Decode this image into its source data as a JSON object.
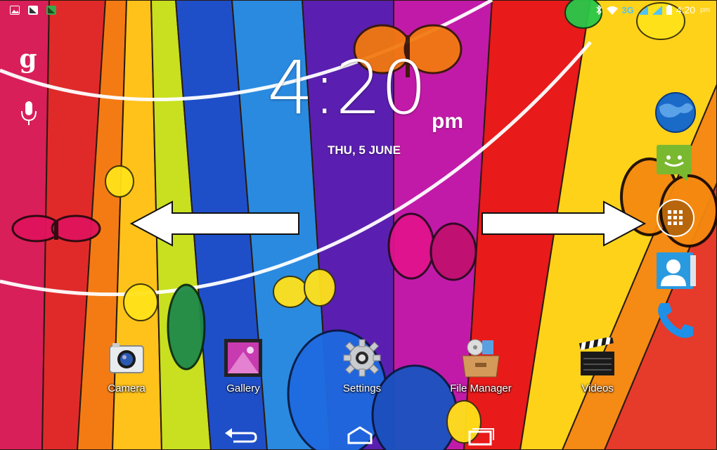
{
  "status_bar": {
    "left_icons": [
      "picture-notification-icon",
      "screenshot-notification-icon",
      "download-notification-icon"
    ],
    "network": "3G",
    "time": "4:20",
    "ampm": "pm"
  },
  "search": {
    "glyph": "g",
    "icon": "google-search-icon"
  },
  "voice": {
    "icon": "microphone-icon"
  },
  "clock": {
    "time": "4:20",
    "ampm": "pm",
    "date": "THU, 5 JUNE"
  },
  "dock": {
    "apps": [
      {
        "label": "Camera",
        "icon": "camera-icon"
      },
      {
        "label": "Gallery",
        "icon": "gallery-icon"
      },
      {
        "label": "Settings",
        "icon": "gear-icon"
      },
      {
        "label": "File Manager",
        "icon": "file-manager-icon"
      },
      {
        "label": "Videos",
        "icon": "clapperboard-icon"
      }
    ]
  },
  "side_dock": {
    "apps": [
      {
        "icon": "browser-globe-icon"
      },
      {
        "icon": "messaging-icon"
      },
      {
        "icon": "all-apps-icon"
      },
      {
        "icon": "contacts-icon"
      },
      {
        "icon": "phone-icon"
      }
    ]
  },
  "nav_bar": {
    "buttons": [
      "back-icon",
      "home-icon",
      "recent-apps-icon"
    ]
  },
  "annotations": {
    "arrows": [
      "left-arrow",
      "right-arrow"
    ]
  },
  "colors": {
    "accent_status": "#4fc3f7",
    "text": "#ffffff"
  }
}
